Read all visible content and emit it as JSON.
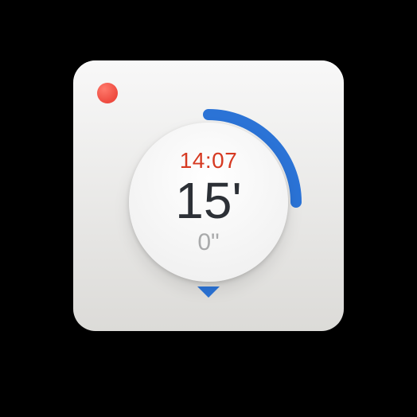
{
  "timer": {
    "current_time": "14:07",
    "minutes_display": "15'",
    "seconds_display": "0\"",
    "progress_fraction": 0.25,
    "accent_color": "#2b73d6",
    "alert_color": "#d63a22"
  }
}
